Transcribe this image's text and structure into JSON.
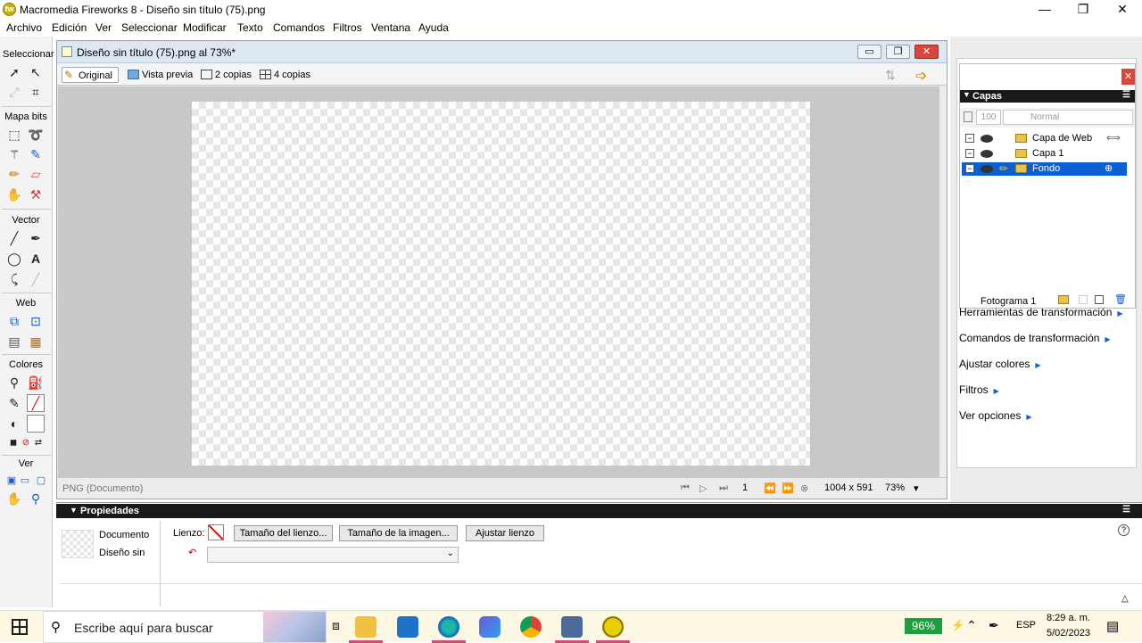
{
  "window": {
    "title": "Macromedia Fireworks 8 - Diseño sin título (75).png",
    "min": "—",
    "max": "❐",
    "close": "✕"
  },
  "menu": [
    "Archivo",
    "Edición",
    "Ver",
    "Seleccionar",
    "Modificar",
    "Texto",
    "Comandos",
    "Filtros",
    "Ventana",
    "Ayuda"
  ],
  "toolbox": {
    "sections": {
      "select": "Seleccionar",
      "bitmap": "Mapa bits",
      "vector": "Vector",
      "web": "Web",
      "colors": "Colores",
      "view": "Ver"
    }
  },
  "document": {
    "title": "Diseño sin título (75).png al  73%*",
    "tabs": {
      "original": "Original",
      "preview": "Vista previa",
      "two_up": "2 copias",
      "four_up": "4 copias"
    },
    "status": {
      "format": "PNG (Documento)",
      "frame": "1",
      "size": "1004 x 591",
      "zoom": "73%"
    }
  },
  "layers": {
    "title": "Capas",
    "opacity": "100",
    "blend": "Normal",
    "rows": [
      {
        "name": "Capa de Web"
      },
      {
        "name": "Capa 1"
      },
      {
        "name": "Fondo"
      }
    ],
    "frame": "Fotograma 1"
  },
  "panels": [
    "Herramientas de transformación",
    "Comandos de transformación",
    "Ajustar colores",
    "Filtros",
    "Ver opciones"
  ],
  "properties": {
    "title": "Propiedades",
    "doc_label": "Documento",
    "doc_name": "Diseño sin",
    "canvas_label": "Lienzo:",
    "btn_canvas_size": "Tamaño del lienzo...",
    "btn_image_size": "Tamaño de la imagen...",
    "btn_fit": "Ajustar lienzo"
  },
  "taskbar": {
    "search_placeholder": "Escribe aquí para buscar",
    "battery": "96%",
    "lang": "ESP",
    "time": "8:29 a. m.",
    "date": "5/02/2023"
  },
  "colors": {
    "accent": "#0a5fd3",
    "close": "#d9463b",
    "battery": "#1e9e3e"
  }
}
